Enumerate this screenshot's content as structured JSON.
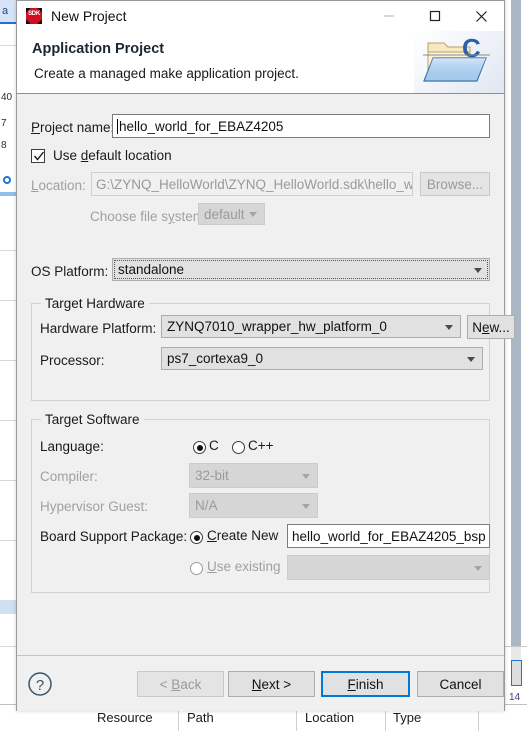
{
  "window": {
    "title": "New Project",
    "app_icon": "sdk-icon",
    "controls": {
      "minimize": "minimize-icon",
      "maximize": "maximize-icon",
      "close": "close-icon"
    }
  },
  "header": {
    "title": "Application Project",
    "subtitle": "Create a managed make application project.",
    "banner_icon": "c-project-folder-icon"
  },
  "form": {
    "project_name": {
      "label": "Project name:",
      "value": "hello_world_for_EBAZ4205"
    },
    "use_default_location": {
      "label": "Use default location",
      "checked": true
    },
    "location": {
      "label": "Location:",
      "value": "G:\\ZYNQ_HelloWorld\\ZYNQ_HelloWorld.sdk\\hello_worl",
      "browse_label": "Browse...",
      "enabled": false
    },
    "file_system": {
      "label": "Choose file system:",
      "value": "default",
      "enabled": false
    },
    "os_platform": {
      "label": "OS Platform:",
      "value": "standalone"
    }
  },
  "target_hardware": {
    "group_label": "Target Hardware",
    "hardware_platform": {
      "label": "Hardware Platform:",
      "value": "ZYNQ7010_wrapper_hw_platform_0",
      "new_label": "New..."
    },
    "processor": {
      "label": "Processor:",
      "value": "ps7_cortexa9_0"
    }
  },
  "target_software": {
    "group_label": "Target Software",
    "language": {
      "label": "Language:",
      "options": [
        "C",
        "C++"
      ],
      "selected": "C"
    },
    "compiler": {
      "label": "Compiler:",
      "value": "32-bit",
      "enabled": false
    },
    "hypervisor_guest": {
      "label": "Hypervisor Guest:",
      "value": "N/A",
      "enabled": false
    },
    "board_support_package": {
      "label": "Board Support Package:",
      "create_new_label": "Create New",
      "create_new_value": "hello_world_for_EBAZ4205_bsp",
      "use_existing_label": "Use existing",
      "use_existing_value": "",
      "selected": "Create New"
    }
  },
  "footer": {
    "help_icon": "help-icon",
    "back_label": "< Back",
    "next_label": "Next >",
    "finish_label": "Finish",
    "cancel_label": "Cancel",
    "back_enabled": false,
    "default_button": "Finish"
  },
  "background": {
    "tab_label": "a",
    "line_numbers": [
      "40",
      "7",
      "8"
    ],
    "problems_columns": [
      "Resource",
      "Path",
      "Location",
      "Type"
    ],
    "right_numbers": [
      "14",
      "14"
    ]
  },
  "colors": {
    "dialog_bg": "#f0f0f0",
    "accent_blue": "#0078d7",
    "field_bg": "#ffffff",
    "disabled_text": "#9a9a9a",
    "border": "#adadad"
  }
}
